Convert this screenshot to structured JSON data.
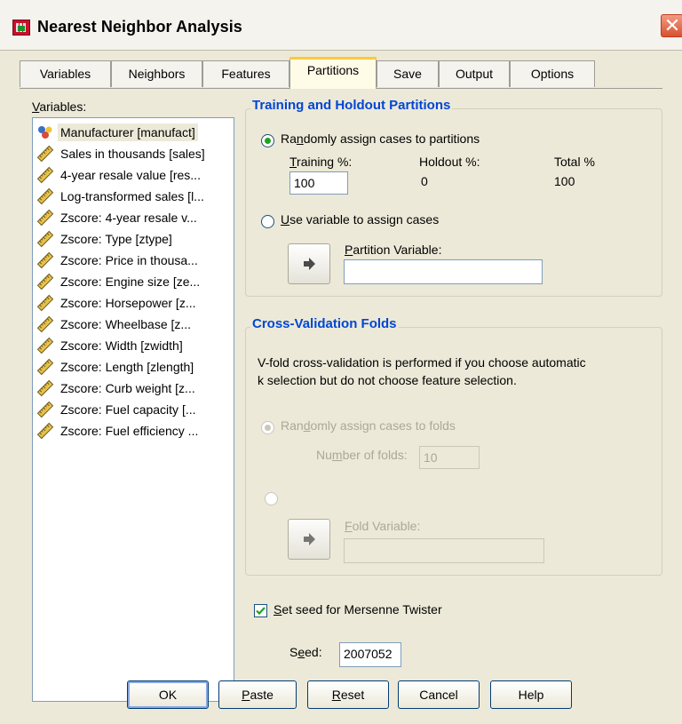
{
  "window": {
    "title": "Nearest Neighbor Analysis",
    "close_glyph": "✕"
  },
  "tabs": [
    {
      "label": "Variables"
    },
    {
      "label": "Neighbors"
    },
    {
      "label": "Features"
    },
    {
      "label": "Partitions",
      "active": true
    },
    {
      "label": "Save"
    },
    {
      "label": "Output"
    },
    {
      "label": "Options"
    }
  ],
  "variables": {
    "label": "Variables:",
    "items": [
      {
        "label": "Manufacturer [manufact]",
        "icon": "nominal-icon",
        "selected": true
      },
      {
        "label": "Sales in thousands [sales]",
        "icon": "scale-icon"
      },
      {
        "label": "4-year resale value [res...",
        "icon": "scale-icon"
      },
      {
        "label": "Log-transformed sales [l...",
        "icon": "scale-icon"
      },
      {
        "label": "Zscore:  4-year resale v...",
        "icon": "scale-icon"
      },
      {
        "label": "Zscore:  Type [ztype]",
        "icon": "scale-icon"
      },
      {
        "label": "Zscore:  Price in thousa...",
        "icon": "scale-icon"
      },
      {
        "label": "Zscore:  Engine size [ze...",
        "icon": "scale-icon"
      },
      {
        "label": "Zscore:  Horsepower [z...",
        "icon": "scale-icon"
      },
      {
        "label": "Zscore:  Wheelbase [z...",
        "icon": "scale-icon"
      },
      {
        "label": "Zscore:  Width [zwidth]",
        "icon": "scale-icon"
      },
      {
        "label": "Zscore:  Length [zlength]",
        "icon": "scale-icon"
      },
      {
        "label": "Zscore:  Curb weight [z...",
        "icon": "scale-icon"
      },
      {
        "label": "Zscore:  Fuel capacity [...",
        "icon": "scale-icon"
      },
      {
        "label": "Zscore:  Fuel efficiency ...",
        "icon": "scale-icon"
      }
    ]
  },
  "partitions": {
    "title": "Training and Holdout Partitions",
    "random_label": "Randomly assign cases to partitions",
    "training_label": "Training %:",
    "holdout_label": "Holdout %:",
    "total_label": "Total %",
    "training_value": "100",
    "holdout_value": "0",
    "total_value": "100",
    "use_var_label": "Use variable to assign cases",
    "partition_var_label": "Partition Variable:",
    "partition_var_value": ""
  },
  "crossval": {
    "title": "Cross-Validation Folds",
    "desc_line1": "V-fold cross-validation is performed if you choose automatic",
    "desc_line2": "k selection but do not choose feature selection.",
    "random_label": "Randomly assign cases to folds",
    "folds_label": "Number of folds:",
    "folds_value": "10",
    "fold_var_label": "Fold Variable:",
    "fold_var_value": ""
  },
  "seed": {
    "checkbox_label": "Set seed for Mersenne Twister",
    "checked": true,
    "seed_label": "Seed:",
    "seed_value": "2007052"
  },
  "buttons": {
    "ok": "OK",
    "paste": "Paste",
    "reset": "Reset",
    "cancel": "Cancel",
    "help": "Help"
  },
  "colors": {
    "dialog_bg": "#ece9d8",
    "group_title": "#0046d5",
    "active_tab_accent": "#ffc83c",
    "close_button": "#d8512f"
  }
}
